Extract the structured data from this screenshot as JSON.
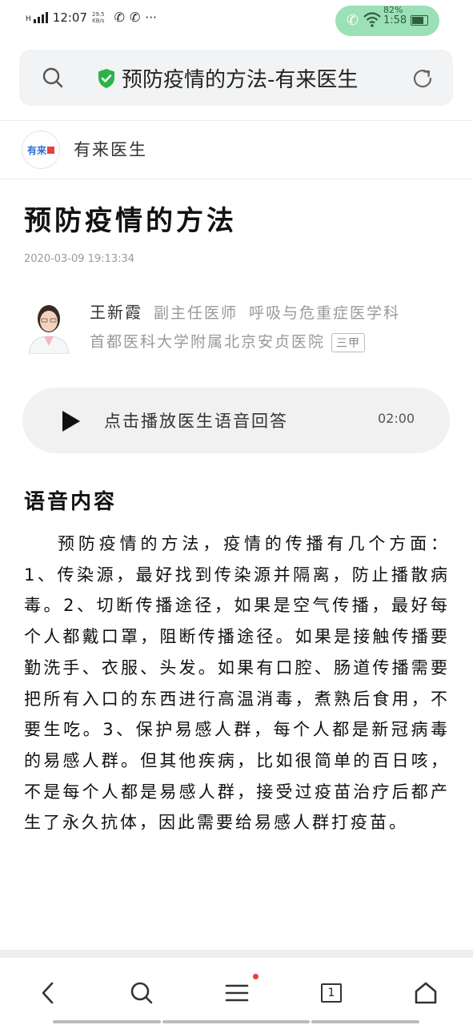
{
  "status_bar": {
    "carrier": "H",
    "time": "12:07",
    "network_speed_top": "29.5",
    "network_speed_bottom": "KB/s",
    "menu": "···",
    "call_time": "1:58",
    "battery": "82%"
  },
  "address_bar": {
    "page_title": "预防疫情的方法-有来医生"
  },
  "site": {
    "logo_text": "有来",
    "name": "有来医生"
  },
  "article": {
    "title": "预防疫情的方法",
    "date": "2020-03-09 19:13:34",
    "doctor": {
      "name": "王新霞",
      "title": "副主任医师",
      "department": "呼吸与危重症医学科",
      "hospital": "首都医科大学附属北京安贞医院",
      "hospital_level": "三甲"
    },
    "audio": {
      "label": "点击播放医生语音回答",
      "duration": "02:00"
    },
    "section_heading": "语音内容",
    "content": "预防疫情的方法，疫情的传播有几个方面：1、传染源，最好找到传染源并隔离，防止播散病毒。2、切断传播途径，如果是空气传播，最好每个人都戴口罩，阻断传播途径。如果是接触传播要勤洗手、衣服、头发。如果有口腔、肠道传播需要把所有入口的东西进行高温消毒，煮熟后食用，不要生吃。3、保护易感人群，每个人都是新冠病毒的易感人群。但其他疾病，比如很简单的百日咳，不是每个人都是易感人群，接受过疫苗治疗后都产生了永久抗体，因此需要给易感人群打疫苗。"
  },
  "bottom_nav": {
    "tabs_count": "1",
    "icons": [
      "back-icon",
      "search-icon",
      "menu-icon",
      "tabs-icon",
      "home-icon"
    ]
  },
  "colors": {
    "call_pill": "#9be0b6",
    "secure_shield": "#2bb34a",
    "logo_blue": "#2d6fd6",
    "notification_dot": "#e5413a"
  }
}
